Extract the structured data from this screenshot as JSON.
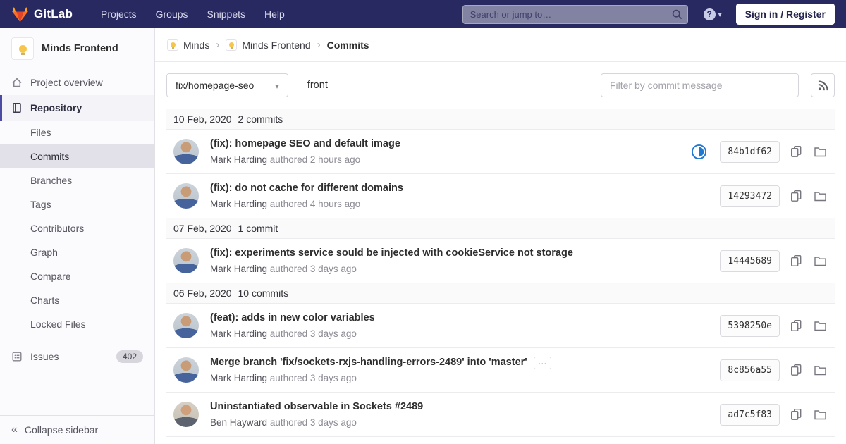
{
  "theme": {
    "navbar_bg": "#292961",
    "active_accent": "#4b4ba3",
    "brand_orange": "#fc6d26",
    "pipeline_running_blue": "#1f78d1"
  },
  "navbar": {
    "brand": "GitLab",
    "links": [
      "Projects",
      "Groups",
      "Snippets",
      "Help"
    ],
    "search_placeholder": "Search or jump to…",
    "sign_in_label": "Sign in / Register"
  },
  "sidebar": {
    "project_name": "Minds Frontend",
    "project_overview": "Project overview",
    "repository": "Repository",
    "repo_items": [
      "Files",
      "Commits",
      "Branches",
      "Tags",
      "Contributors",
      "Graph",
      "Compare",
      "Charts",
      "Locked Files"
    ],
    "issues_label": "Issues",
    "issues_count": "402",
    "collapse_label": "Collapse sidebar"
  },
  "breadcrumb": {
    "items": [
      "Minds",
      "Minds Frontend",
      "Commits"
    ]
  },
  "controls": {
    "branch": "fix/homepage-seo",
    "path": "front",
    "filter_placeholder": "Filter by commit message"
  },
  "commits": {
    "groups": [
      {
        "date": "10 Feb, 2020",
        "count": "2 commits",
        "items": [
          {
            "title": "(fix): homepage SEO and default image",
            "author": "Mark Harding",
            "meta": "authored 2 hours ago",
            "sha": "84b1df62"
          },
          {
            "title": "(fix): do not cache for different domains",
            "author": "Mark Harding",
            "meta": "authored 4 hours ago",
            "sha": "14293472"
          }
        ]
      },
      {
        "date": "07 Feb, 2020",
        "count": "1 commit",
        "items": [
          {
            "title": "(fix): experiments service sould be injected with cookieService not storage",
            "author": "Mark Harding",
            "meta": "authored 3 days ago",
            "sha": "14445689"
          }
        ]
      },
      {
        "date": "06 Feb, 2020",
        "count": "10 commits",
        "items": [
          {
            "title": "(feat): adds in new color variables",
            "author": "Mark Harding",
            "meta": "authored 3 days ago",
            "sha": "5398250e"
          },
          {
            "title": "Merge branch 'fix/sockets-rxjs-handling-errors-2489' into 'master'",
            "toggle": "…",
            "author": "Mark Harding",
            "meta": "authored 3 days ago",
            "sha": "8c856a55"
          },
          {
            "title": "Uninstantiated observable in Sockets #2489",
            "author": "Ben Hayward",
            "meta": "authored 3 days ago",
            "sha": "ad7c5f83"
          }
        ]
      }
    ]
  }
}
